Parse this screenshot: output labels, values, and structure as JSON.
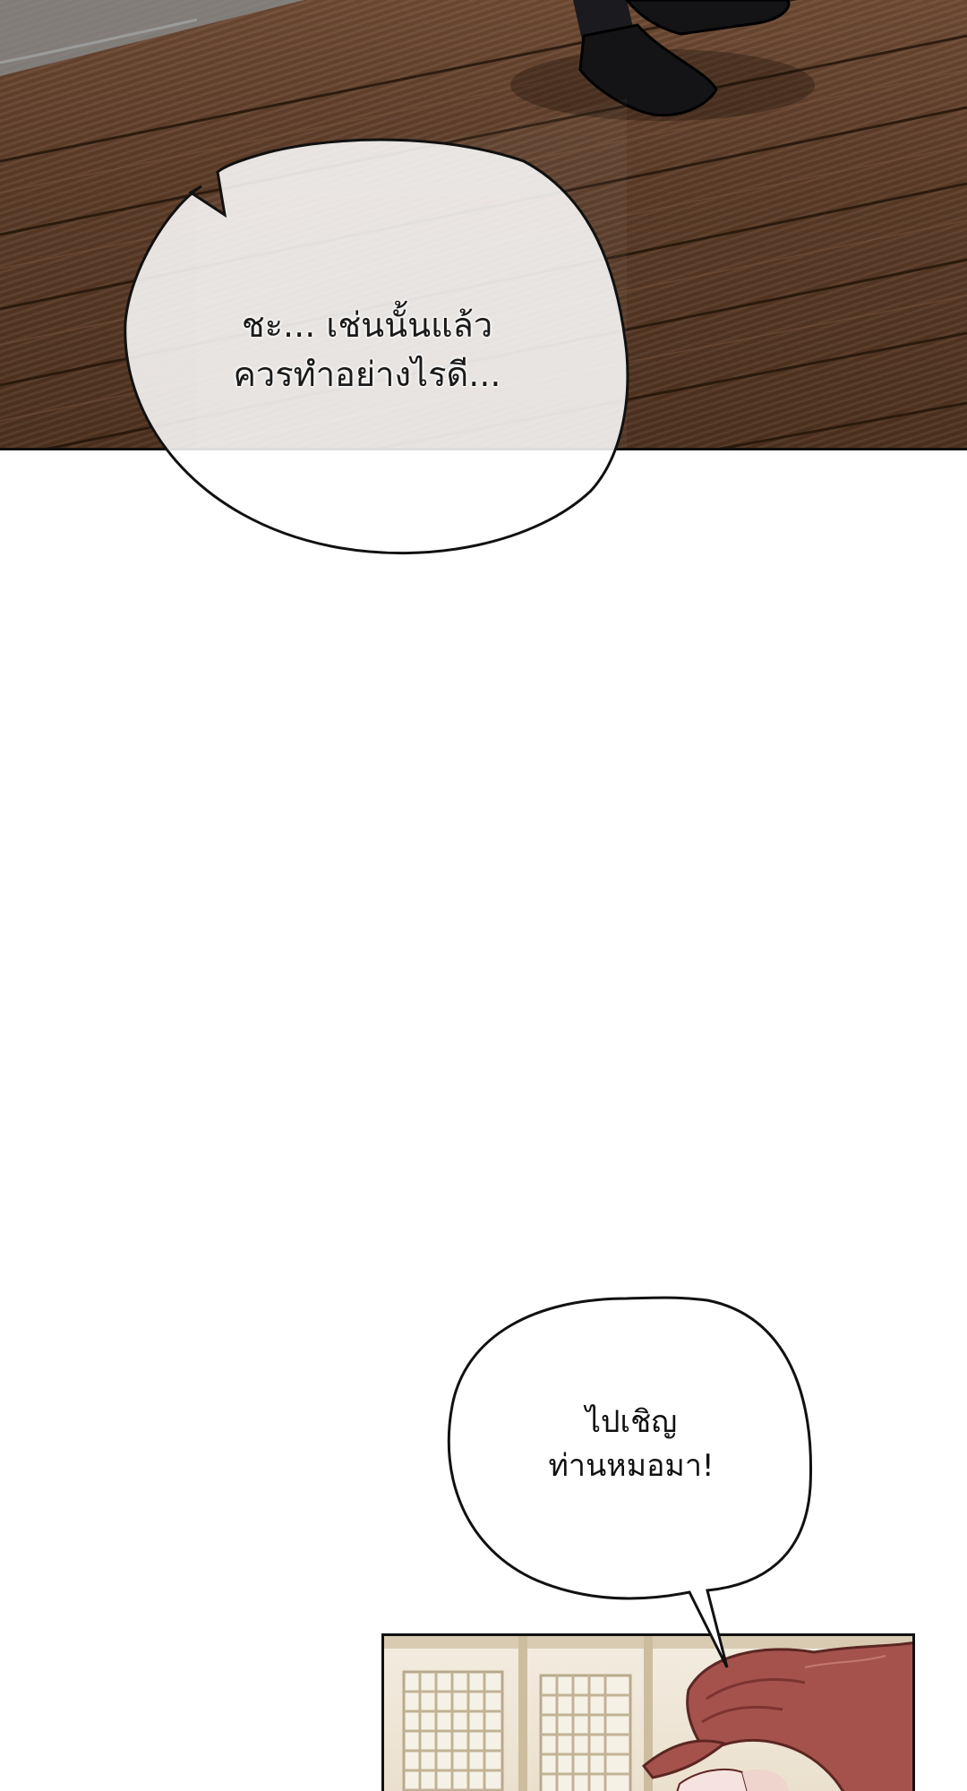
{
  "bubbles": [
    {
      "lines": [
        "ชะ... เช่นนั้นแล้ว",
        "ควรทำอย่างไรดี..."
      ]
    },
    {
      "lines": [
        "ไปเชิญ",
        "ท่านหมอมา!"
      ]
    }
  ],
  "colors": {
    "floor": "#5a3a26",
    "ink": "#111111",
    "bubble_fill": "#ffffff",
    "hair": "#a5524d",
    "shoji": "#eadfcc"
  }
}
